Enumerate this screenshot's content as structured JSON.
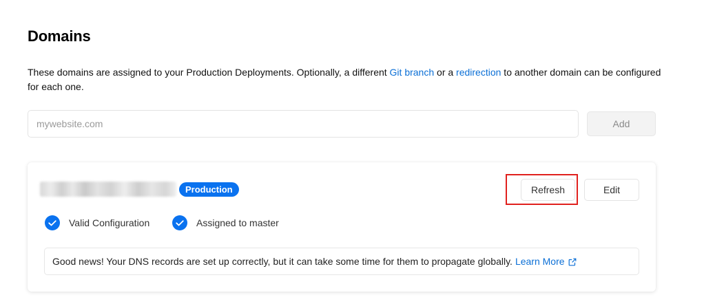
{
  "page": {
    "title": "Domains",
    "description_before_link1": "These domains are assigned to your Production Deployments. Optionally, a different ",
    "link1": "Git branch",
    "description_between": " or a ",
    "link2": "redirection",
    "description_after": " to another domain can be configured for each one."
  },
  "add_form": {
    "placeholder": "mywebsite.com",
    "value": "",
    "add_label": "Add"
  },
  "domain_card": {
    "badge": "Production",
    "refresh_label": "Refresh",
    "edit_label": "Edit",
    "statuses": [
      {
        "label": "Valid Configuration",
        "icon": "check-circle-icon"
      },
      {
        "label": "Assigned to master",
        "icon": "check-circle-icon"
      }
    ],
    "info_message": "Good news! Your DNS records are set up correctly, but it can take some time for them to propagate globally.",
    "learn_more": "Learn More",
    "learn_more_icon": "external-link-icon"
  },
  "colors": {
    "accent": "#0a72ef",
    "link": "#0b6fd6",
    "highlight": "#e0201d"
  }
}
